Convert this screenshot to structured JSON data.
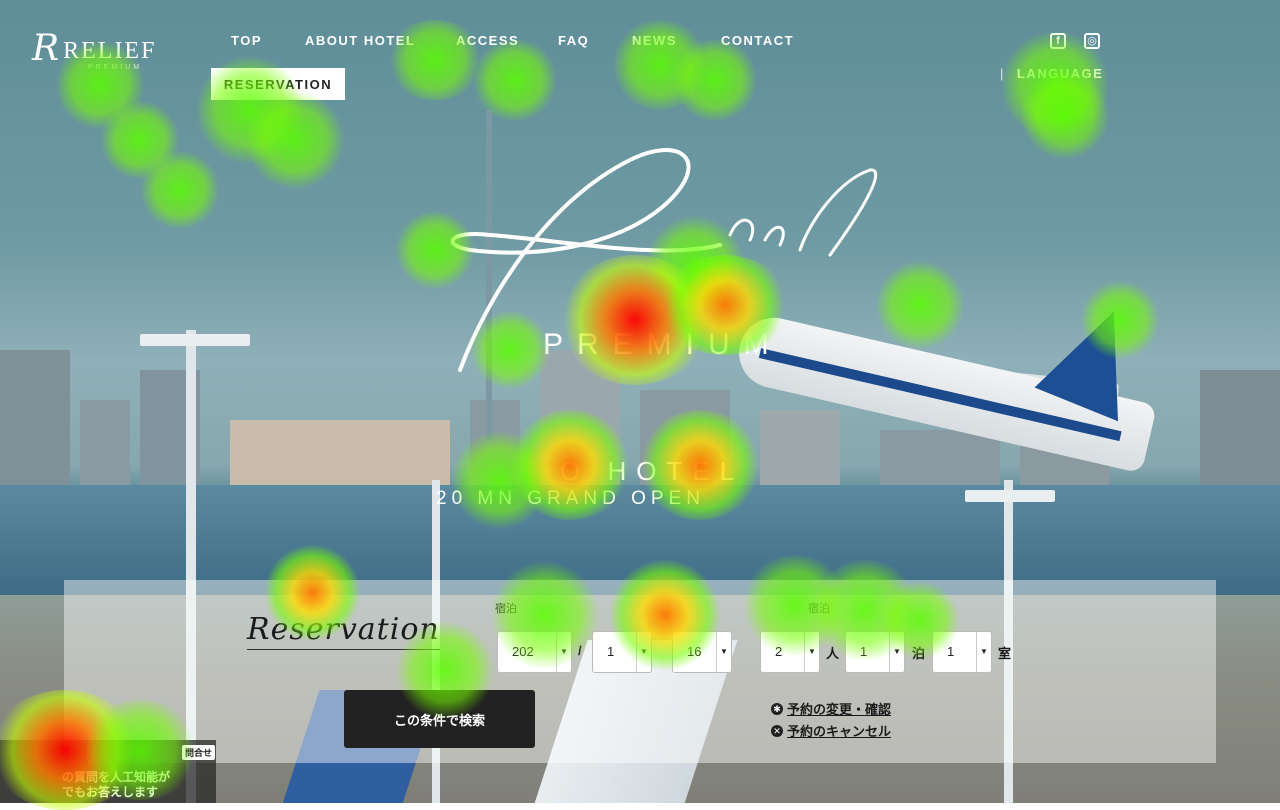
{
  "header": {
    "logo_mark": "R",
    "logo_text": "RELIEF",
    "logo_sub": "PREMIUM",
    "nav": [
      "TOP",
      "ABOUT HOTEL",
      "ACCESS",
      "FAQ",
      "NEWS",
      "CONTACT"
    ],
    "reservation_label": "RESERVATION",
    "language_label": "LANGUAGE",
    "sns": {
      "facebook_icon": "facebook-icon",
      "instagram_icon": "instagram-icon"
    }
  },
  "hero": {
    "script_text": "Relief",
    "premium": "PREMIUM",
    "hotel": "O HOTEL",
    "open_text": "20   MN GRAND OPEN"
  },
  "reservation": {
    "title": "Reservation",
    "checkin_label": "宿泊",
    "guests_label": "宿泊",
    "year": "202",
    "month": "1",
    "day": "16",
    "date_sep": "/",
    "guests": "2",
    "guests_unit": "人",
    "nights": "1",
    "nights_unit": "泊",
    "rooms": "1",
    "rooms_unit": "室",
    "search_label": "この条件で検索",
    "change_label": "予約の変更・確認",
    "cancel_label": "予約のキャンセル"
  },
  "chat": {
    "badge": "問合せ",
    "line1": "の質問を人工知能が",
    "line2": "でもお答えします"
  },
  "colors": {
    "accent_dark": "#222222",
    "panel_bg": "rgba(255,255,255,0.45)",
    "plane_blue": "#1d4f94"
  }
}
